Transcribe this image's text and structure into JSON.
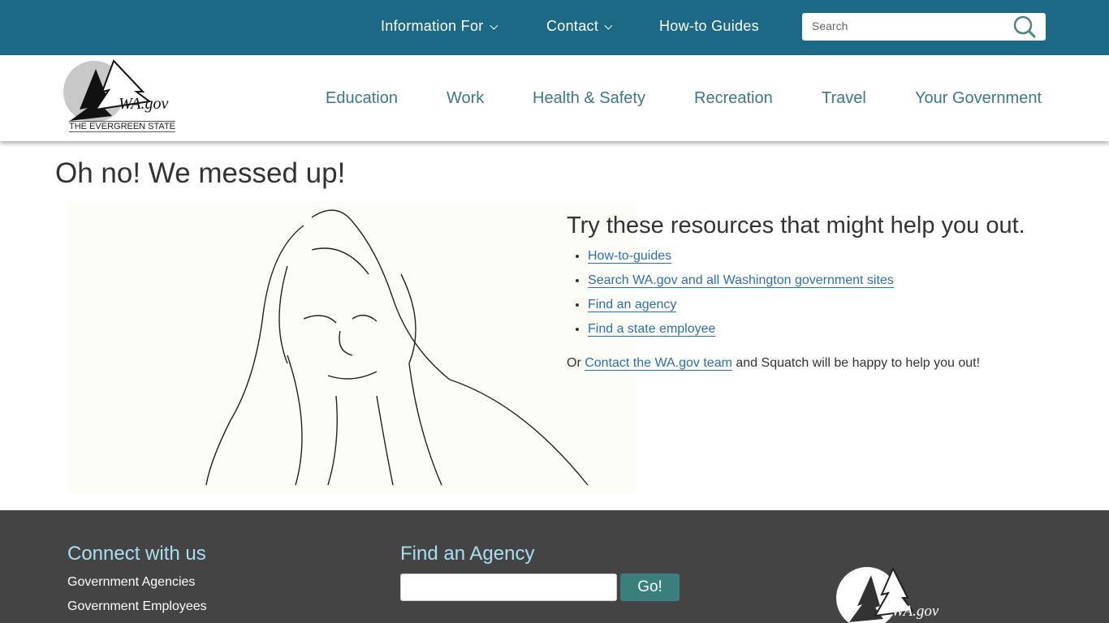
{
  "topbar": {
    "items": [
      {
        "label": "Information For",
        "dropdown": true
      },
      {
        "label": "Contact",
        "dropdown": true
      },
      {
        "label": "How-to Guides",
        "dropdown": false
      }
    ],
    "search_placeholder": "Search",
    "search_icon": "search-icon"
  },
  "logo": {
    "text": "WA.gov",
    "tagline": "THE EVERGREEN STATE"
  },
  "mainnav": [
    "Education",
    "Work",
    "Health & Safety",
    "Recreation",
    "Travel",
    "Your Government"
  ],
  "main": {
    "title": "Oh no! We messed up!",
    "resources_heading": "Try these resources that might help you out.",
    "links": [
      "How-to-guides",
      "Search WA.gov and all Washington government sites",
      "Find an agency",
      "Find a state employee"
    ],
    "contact_prefix": "Or ",
    "contact_link": "Contact the WA.gov team",
    "contact_suffix": " and Squatch will be happy to help you out!"
  },
  "footer": {
    "connect_heading": "Connect with us",
    "connect_links": [
      "Government Agencies",
      "Government Employees"
    ],
    "agency_heading": "Find an Agency",
    "go_label": "Go!",
    "logo_text": "WA.gov"
  },
  "colors": {
    "topbar": "#1b6984",
    "nav_text": "#3b7a82",
    "link": "#2a6fb0",
    "footer": "#444444",
    "footer_heading": "#a6e0ef",
    "go_button": "#3a7f7c"
  }
}
